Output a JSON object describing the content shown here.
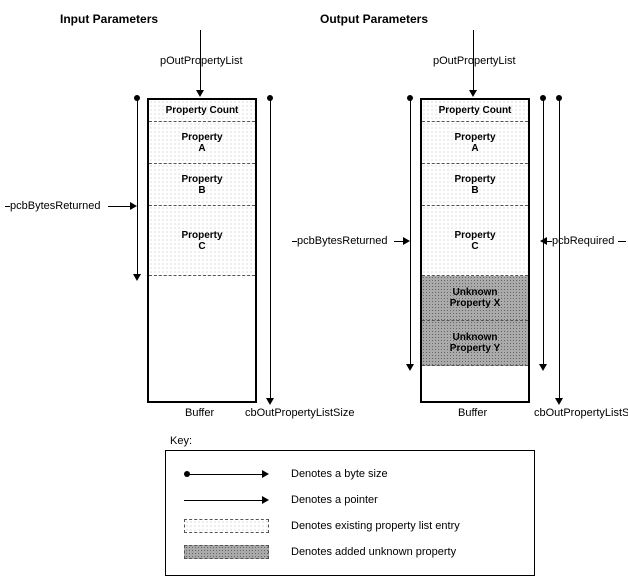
{
  "titles": {
    "input": "Input Parameters",
    "output": "Output Parameters"
  },
  "pointer_label": "pOutPropertyList",
  "segments": {
    "count": "Property Count",
    "a_1": "Property",
    "a_2": "A",
    "b_1": "Property",
    "b_2": "B",
    "c_1": "Property",
    "c_2": "C",
    "ux_1": "Unknown",
    "ux_2": "Property X",
    "uy_1": "Unknown",
    "uy_2": "Property Y"
  },
  "labels": {
    "buffer": "Buffer",
    "cb_out": "cbOutPropertyListSize",
    "pcb_returned": "pcbBytesReturned",
    "pcb_required": "pcbRequired"
  },
  "key": {
    "title": "Key:",
    "byte_size": "Denotes a byte size",
    "pointer": "Denotes a pointer",
    "existing": "Denotes existing property list entry",
    "unknown": "Denotes added unknown property"
  }
}
